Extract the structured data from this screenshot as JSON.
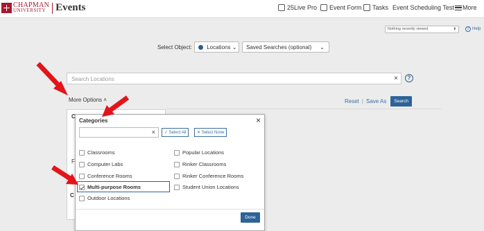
{
  "header": {
    "brand_line1": "CHAPMAN",
    "brand_line2": "UNIVERSITY",
    "app_name": "Events",
    "nav": {
      "pro": "25Live Pro",
      "event_form": "Event Form",
      "tasks": "Tasks",
      "user": "Event Scheduling Test",
      "more": "More"
    }
  },
  "recent": {
    "selected": "Nothing recently viewed"
  },
  "help": {
    "label": "Help"
  },
  "select_object": {
    "label": "Select Object:",
    "object_value": "Locations",
    "saved_searches": "Saved Searches (optional)"
  },
  "search": {
    "placeholder": "Search Locations",
    "clear": "×",
    "help": "?"
  },
  "more_options": {
    "label": "More Options"
  },
  "actions": {
    "reset": "Reset",
    "save_as": "Save As",
    "search": "Search"
  },
  "underpanel": {
    "peek1": "C",
    "peek2": "F",
    "peek3": "C"
  },
  "modal": {
    "title": "Categories",
    "close": "×",
    "filter_clear": "×",
    "select_all": "Select All",
    "select_none": "Select None",
    "left_items": [
      {
        "label": "Classrooms",
        "checked": false
      },
      {
        "label": "Computer Labs",
        "checked": false
      },
      {
        "label": "Conference Rooms",
        "checked": false
      },
      {
        "label": "Multi-purpose Rooms",
        "checked": true
      },
      {
        "label": "Outdoor Locations",
        "checked": false
      }
    ],
    "right_items": [
      {
        "label": "Popular Locations",
        "checked": false
      },
      {
        "label": "Rinker Classrooms",
        "checked": false
      },
      {
        "label": "Rinker Conference Rooms",
        "checked": false
      },
      {
        "label": "Student Union Locations",
        "checked": false
      }
    ],
    "done": "Done"
  },
  "colors": {
    "brand": "#a6192e",
    "primary": "#2d6399",
    "annotation": "#e3141a"
  }
}
